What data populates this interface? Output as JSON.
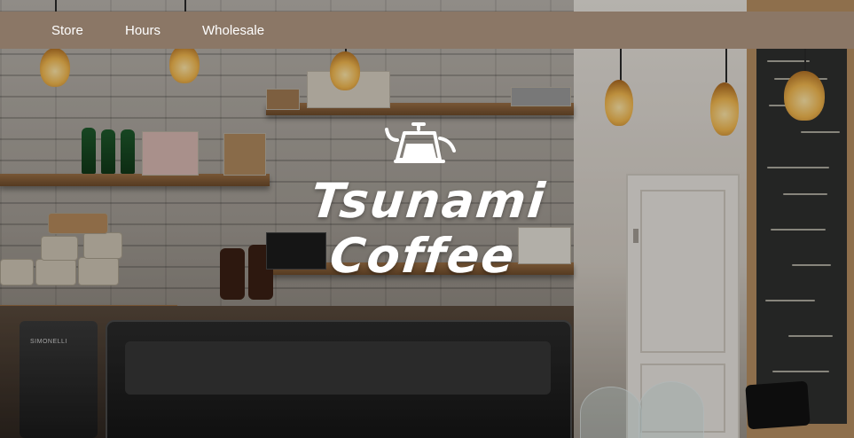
{
  "nav": {
    "items": [
      {
        "label": "Store"
      },
      {
        "label": "Hours"
      },
      {
        "label": "Wholesale"
      }
    ]
  },
  "hero": {
    "logo_icon": "kettle-icon",
    "title_line1": "Tsunami",
    "title_line2": "Coffee"
  },
  "colors": {
    "navbar": "#8b7766",
    "nav_text": "#ffffff",
    "title_text": "#ffffff"
  }
}
